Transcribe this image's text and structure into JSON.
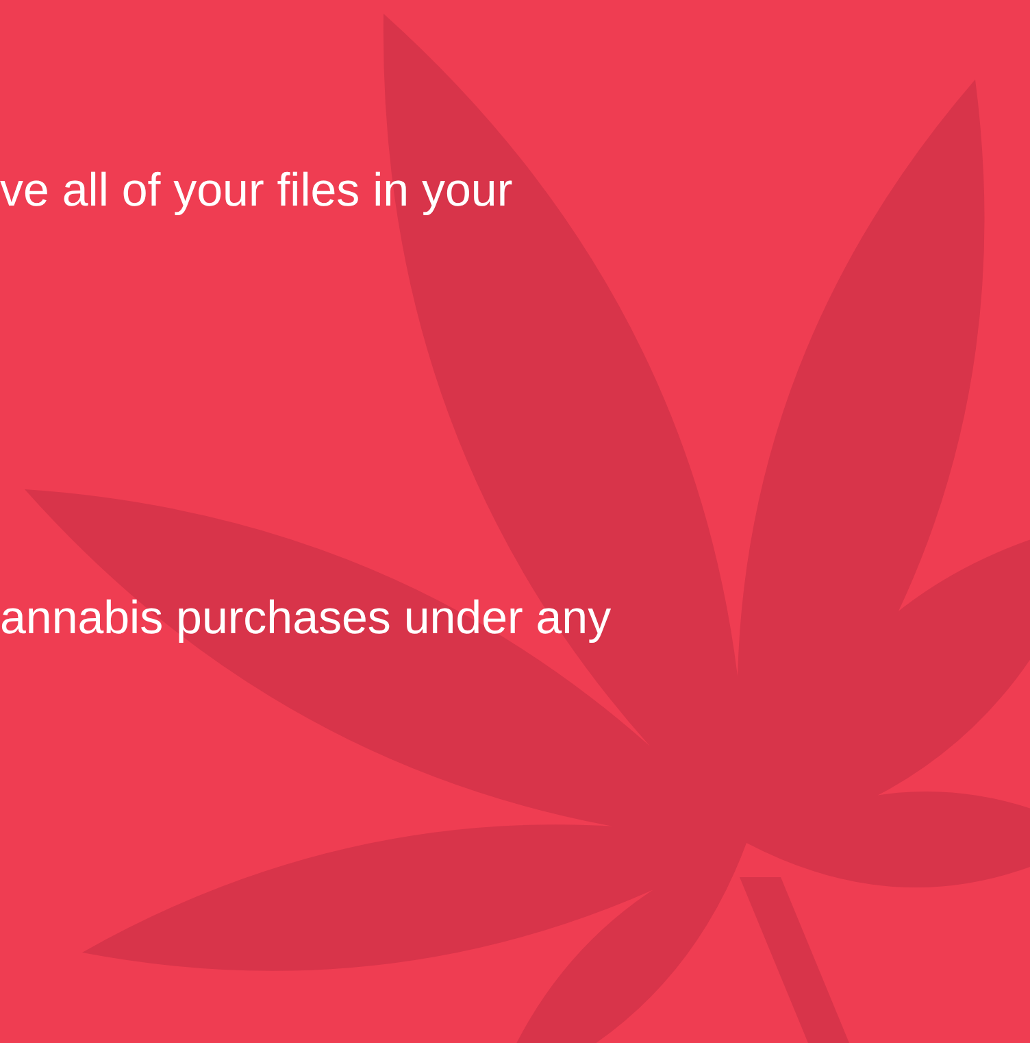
{
  "paragraphs": [
    {
      "text": "ve all of your files in your"
    },
    {
      "text": "annabis purchases under any"
    }
  ]
}
